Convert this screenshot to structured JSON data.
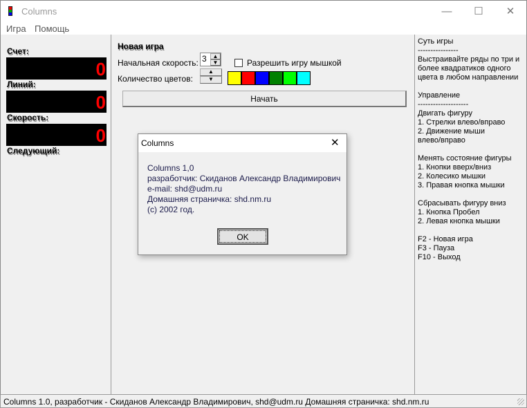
{
  "window": {
    "title": "Columns",
    "minimize": "—",
    "maximize": "☐",
    "close": "✕"
  },
  "menu": [
    "Игра",
    "Помощь"
  ],
  "left": {
    "score_label": "Счет:",
    "score": "0",
    "lines_label": "Линий:",
    "lines": "0",
    "speed_label": "Скорость:",
    "speed": "0",
    "next_label": "Следующий:"
  },
  "newgame": {
    "heading": "Новая игра",
    "speed_label": "Начальная скорость:",
    "speed_value": "3",
    "colors_label": "Количество цветов:",
    "mouse_label": "Разрешить игру мышкой",
    "mouse_checked": false,
    "colors": [
      "#ffff00",
      "#ff0000",
      "#0000ff",
      "#008000",
      "#00ff00",
      "#00ffff"
    ],
    "start": "Начать"
  },
  "help": "Суть игры\n----------------\nВыстраивайте ряды по три и\nболее квадратиков одного\nцвета в любом направлении\n\nУправление\n--------------------\nДвигать фигуру\n1. Стрелки влево/вправо\n2. Движение мыши\nвлево/вправо\n\nМенять состояние фигуры\n1. Кнопки вверх/вниз\n2. Колесико мышки\n3. Правая кнопка мышки\n\nСбрасывать фигуру вниз\n1. Кнопка Пробел\n2. Левая кнопка мышки\n\nF2 - Новая игра\nF3 - Пауза\nF10 - Выход",
  "status": "Columns 1.0, разработчик - Скиданов Александр Владимирович, shd@udm.ru Домашняя страничка: shd.nm.ru",
  "dialog": {
    "title": "Columns",
    "close": "✕",
    "text": "Columns 1,0\nразработчик: Скиданов Александр Владимирович\ne-mail: shd@udm.ru\nДомашняя страничка: shd.nm.ru\n(c) 2002 год.",
    "ok": "OK"
  }
}
